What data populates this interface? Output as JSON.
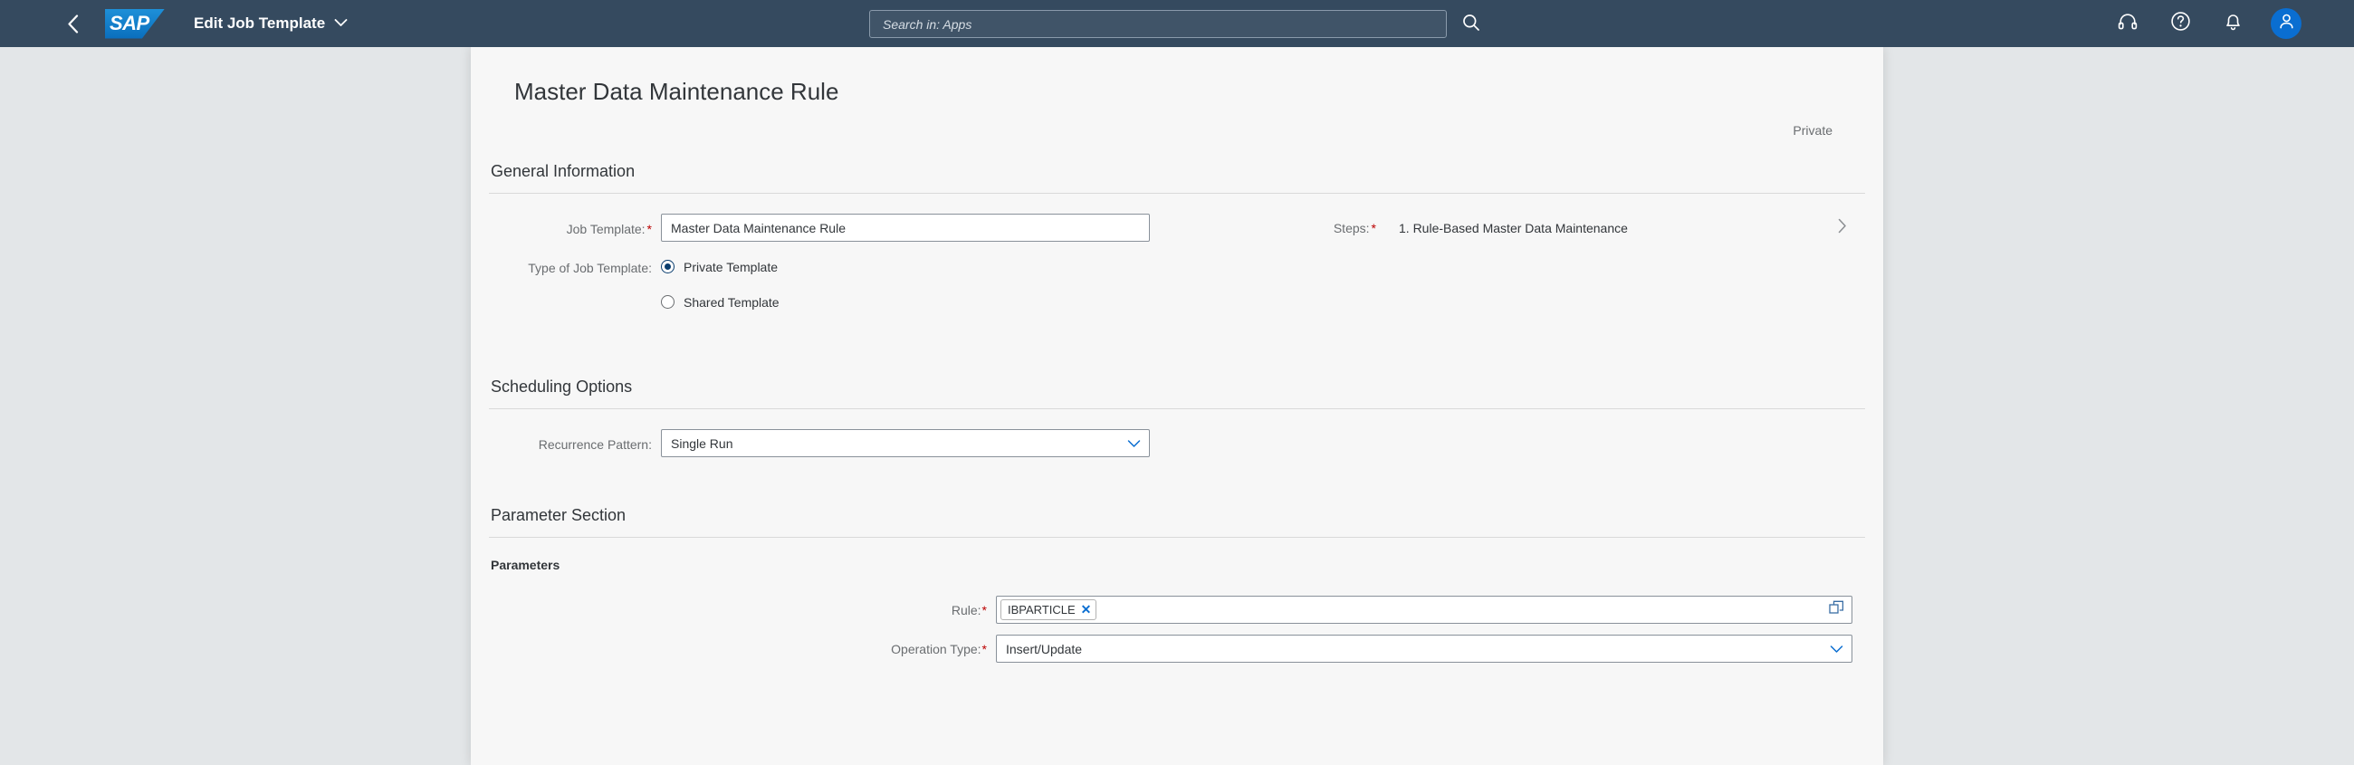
{
  "shellbar": {
    "back_icon": "chevron-left-icon",
    "logo_text": "SAP",
    "title": "Edit Job Template",
    "title_chevron_icon": "chevron-down-icon",
    "search": {
      "placeholder": "Search in: Apps",
      "value": "",
      "search_icon": "search-icon"
    },
    "icons": [
      {
        "name": "support-headset-icon",
        "label": "Contact Support"
      },
      {
        "name": "help-question-icon",
        "label": "Help"
      },
      {
        "name": "notification-bell-icon",
        "label": "Notifications"
      }
    ],
    "avatar": {
      "name": "user-avatar",
      "icon": "person-icon"
    }
  },
  "page": {
    "title": "Master Data Maintenance Rule",
    "status": "Private"
  },
  "general_information": {
    "title": "General Information",
    "job_template": {
      "label": "Job Template:",
      "required": true,
      "value": "Master Data Maintenance Rule",
      "placeholder": ""
    },
    "type_of_job_template": {
      "label": "Type of Job Template:",
      "required": false,
      "options": [
        {
          "label": "Private Template",
          "selected": true
        },
        {
          "label": "Shared Template",
          "selected": false
        }
      ]
    },
    "steps": {
      "label": "Steps:",
      "required": true,
      "value": "1. Rule-Based Master Data Maintenance",
      "nav_icon": "chevron-right-icon"
    }
  },
  "scheduling_options": {
    "title": "Scheduling Options",
    "recurrence_pattern": {
      "label": "Recurrence Pattern:",
      "required": false,
      "value": "Single Run",
      "chevron_icon": "chevron-down-icon"
    }
  },
  "parameter_section": {
    "title": "Parameter Section",
    "subtitle": "Parameters",
    "rule": {
      "label": "Rule:",
      "required": true,
      "tokens": [
        {
          "text": "IBPARTICLE",
          "remove_icon": "close-x-icon"
        }
      ],
      "value_help_icon": "value-help-icon"
    },
    "operation_type": {
      "label": "Operation Type:",
      "required": true,
      "value": "Insert/Update",
      "chevron_icon": "chevron-down-icon"
    }
  },
  "colors": {
    "shell_bg": "#354a5f",
    "accent_blue": "#0a6ed1",
    "required_red": "#bb0000",
    "panel_bg": "#f7f7f7",
    "canvas_bg": "#e3e6e8",
    "label_gray": "#6a6d70",
    "text_dark": "#32363a"
  }
}
